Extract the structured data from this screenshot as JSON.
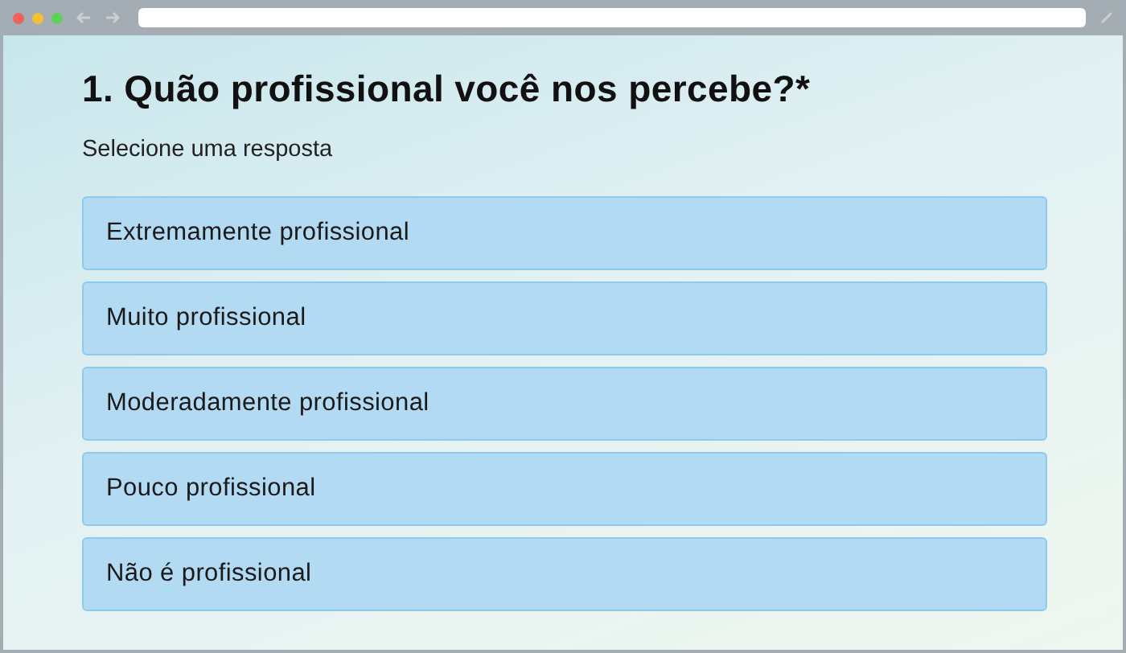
{
  "question": {
    "title": "1. Quão profissional você nos percebe?*",
    "hint": "Selecione uma resposta"
  },
  "options": [
    {
      "label": "Extremamente profissional",
      "selected": false
    },
    {
      "label": "Muito profissional",
      "selected": false
    },
    {
      "label": "Moderadamente profissional",
      "selected": false
    },
    {
      "label": "Pouco profissional",
      "selected": false
    },
    {
      "label": "Não é profissional",
      "selected": false
    }
  ]
}
